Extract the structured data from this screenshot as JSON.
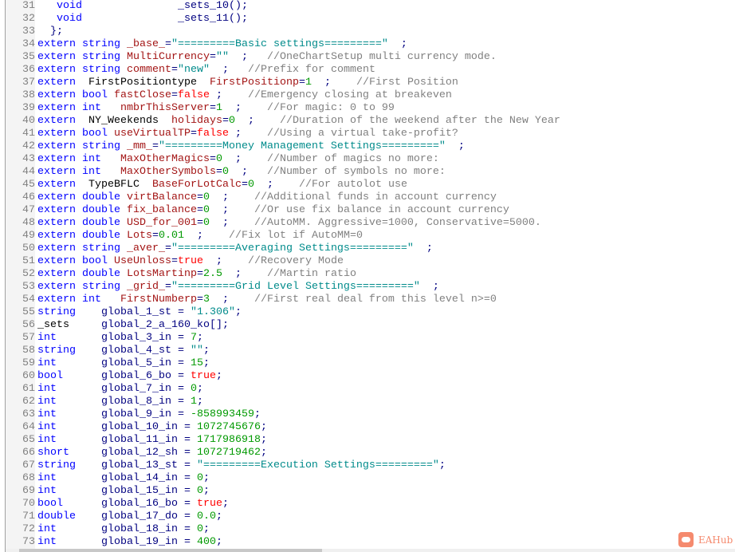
{
  "editor": {
    "lines": [
      {
        "no": "31",
        "tokens": [
          [
            "t",
            "   "
          ],
          [
            "k",
            "void"
          ],
          [
            "t",
            "               "
          ],
          [
            "p",
            "_sets_10();"
          ]
        ]
      },
      {
        "no": "32",
        "tokens": [
          [
            "t",
            "   "
          ],
          [
            "k",
            "void"
          ],
          [
            "t",
            "               "
          ],
          [
            "p",
            "_sets_11();"
          ]
        ]
      },
      {
        "no": "33",
        "tokens": [
          [
            "p",
            "  };"
          ]
        ]
      },
      {
        "no": "34",
        "tokens": [
          [
            "k",
            "extern string "
          ],
          [
            "i",
            "_base_"
          ],
          [
            "p",
            "="
          ],
          [
            "s",
            "\"=========Basic settings=========\""
          ],
          [
            "p",
            "  ;"
          ]
        ]
      },
      {
        "no": "35",
        "tokens": [
          [
            "k",
            "extern string "
          ],
          [
            "i",
            "MultiCurrency"
          ],
          [
            "p",
            "="
          ],
          [
            "s",
            "\"\""
          ],
          [
            "p",
            "  ;   "
          ],
          [
            "c",
            "//OneChartSetup multi currency mode."
          ]
        ]
      },
      {
        "no": "36",
        "tokens": [
          [
            "k",
            "extern string "
          ],
          [
            "i",
            "comment"
          ],
          [
            "p",
            "="
          ],
          [
            "s",
            "\"new\""
          ],
          [
            "p",
            "  ;   "
          ],
          [
            "c",
            "//Prefix for comment"
          ]
        ]
      },
      {
        "no": "37",
        "tokens": [
          [
            "k",
            "extern  "
          ],
          [
            "t",
            "FirstPositiontype  "
          ],
          [
            "i",
            "FirstPositionp"
          ],
          [
            "p",
            "="
          ],
          [
            "n",
            "1"
          ],
          [
            "p",
            "  ;    "
          ],
          [
            "c",
            "//First Position"
          ]
        ]
      },
      {
        "no": "38",
        "tokens": [
          [
            "k",
            "extern bool "
          ],
          [
            "i",
            "fastClose"
          ],
          [
            "p",
            "="
          ],
          [
            "b",
            "false"
          ],
          [
            "p",
            " ;    "
          ],
          [
            "c",
            "//Emergency closing at breakeven"
          ]
        ]
      },
      {
        "no": "39",
        "tokens": [
          [
            "k",
            "extern int   "
          ],
          [
            "i",
            "nmbrThisServer"
          ],
          [
            "p",
            "="
          ],
          [
            "n",
            "1"
          ],
          [
            "p",
            "  ;    "
          ],
          [
            "c",
            "//For magic: 0 to 99"
          ]
        ]
      },
      {
        "no": "40",
        "tokens": [
          [
            "k",
            "extern  "
          ],
          [
            "t",
            "NY_Weekends  "
          ],
          [
            "i",
            "holidays"
          ],
          [
            "p",
            "="
          ],
          [
            "n",
            "0"
          ],
          [
            "p",
            "  ;    "
          ],
          [
            "c",
            "//Duration of the weekend after the New Year"
          ]
        ]
      },
      {
        "no": "41",
        "tokens": [
          [
            "k",
            "extern bool "
          ],
          [
            "i",
            "useVirtualTP"
          ],
          [
            "p",
            "="
          ],
          [
            "b",
            "false"
          ],
          [
            "p",
            " ;    "
          ],
          [
            "c",
            "//Using a virtual take-profit?"
          ]
        ]
      },
      {
        "no": "42",
        "tokens": [
          [
            "k",
            "extern string "
          ],
          [
            "i",
            "_mm_"
          ],
          [
            "p",
            "="
          ],
          [
            "s",
            "\"=========Money Management Settings=========\""
          ],
          [
            "p",
            "  ;"
          ]
        ]
      },
      {
        "no": "43",
        "tokens": [
          [
            "k",
            "extern int   "
          ],
          [
            "i",
            "MaxOtherMagics"
          ],
          [
            "p",
            "="
          ],
          [
            "n",
            "0"
          ],
          [
            "p",
            "  ;    "
          ],
          [
            "c",
            "//Number of magics no more:"
          ]
        ]
      },
      {
        "no": "44",
        "tokens": [
          [
            "k",
            "extern int   "
          ],
          [
            "i",
            "MaxOtherSymbols"
          ],
          [
            "p",
            "="
          ],
          [
            "n",
            "0"
          ],
          [
            "p",
            "  ;   "
          ],
          [
            "c",
            "//Number of symbols no more:"
          ]
        ]
      },
      {
        "no": "45",
        "tokens": [
          [
            "k",
            "extern  "
          ],
          [
            "t",
            "TypeBFLC  "
          ],
          [
            "i",
            "BaseForLotCalc"
          ],
          [
            "p",
            "="
          ],
          [
            "n",
            "0"
          ],
          [
            "p",
            "  ;    "
          ],
          [
            "c",
            "//For autolot use"
          ]
        ]
      },
      {
        "no": "46",
        "tokens": [
          [
            "k",
            "extern double "
          ],
          [
            "i",
            "virtBalance"
          ],
          [
            "p",
            "="
          ],
          [
            "n",
            "0"
          ],
          [
            "p",
            "  ;    "
          ],
          [
            "c",
            "//Additional funds in account currency"
          ]
        ]
      },
      {
        "no": "47",
        "tokens": [
          [
            "k",
            "extern double "
          ],
          [
            "i",
            "fix_balance"
          ],
          [
            "p",
            "="
          ],
          [
            "n",
            "0"
          ],
          [
            "p",
            "  ;    "
          ],
          [
            "c",
            "//Or use fix balance in account currency"
          ]
        ]
      },
      {
        "no": "48",
        "tokens": [
          [
            "k",
            "extern double "
          ],
          [
            "i",
            "USD_for_001"
          ],
          [
            "p",
            "="
          ],
          [
            "n",
            "0"
          ],
          [
            "p",
            "  ;    "
          ],
          [
            "c",
            "//AutoMM. Aggressive=1000, Conservative=5000."
          ]
        ]
      },
      {
        "no": "49",
        "tokens": [
          [
            "k",
            "extern double "
          ],
          [
            "i",
            "Lots"
          ],
          [
            "p",
            "="
          ],
          [
            "n",
            "0.01"
          ],
          [
            "p",
            "  ;    "
          ],
          [
            "c",
            "//Fix lot if AutoMM=0"
          ]
        ]
      },
      {
        "no": "50",
        "tokens": [
          [
            "k",
            "extern string "
          ],
          [
            "i",
            "_aver_"
          ],
          [
            "p",
            "="
          ],
          [
            "s",
            "\"=========Averaging Settings=========\""
          ],
          [
            "p",
            "  ;"
          ]
        ]
      },
      {
        "no": "51",
        "tokens": [
          [
            "k",
            "extern bool "
          ],
          [
            "i",
            "UseUnloss"
          ],
          [
            "p",
            "="
          ],
          [
            "b",
            "true"
          ],
          [
            "p",
            "  ;    "
          ],
          [
            "c",
            "//Recovery Mode"
          ]
        ]
      },
      {
        "no": "52",
        "tokens": [
          [
            "k",
            "extern double "
          ],
          [
            "i",
            "LotsMartinp"
          ],
          [
            "p",
            "="
          ],
          [
            "n",
            "2.5"
          ],
          [
            "p",
            "  ;    "
          ],
          [
            "c",
            "//Martin ratio"
          ]
        ]
      },
      {
        "no": "53",
        "tokens": [
          [
            "k",
            "extern string "
          ],
          [
            "i",
            "_grid_"
          ],
          [
            "p",
            "="
          ],
          [
            "s",
            "\"=========Grid Level Settings=========\""
          ],
          [
            "p",
            "  ;"
          ]
        ]
      },
      {
        "no": "54",
        "tokens": [
          [
            "k",
            "extern int   "
          ],
          [
            "i",
            "FirstNumberp"
          ],
          [
            "p",
            "="
          ],
          [
            "n",
            "3"
          ],
          [
            "p",
            "  ;    "
          ],
          [
            "c",
            "//First real deal from this level n>=0"
          ]
        ]
      },
      {
        "no": "55",
        "tokens": [
          [
            "k",
            "string"
          ],
          [
            "p",
            "    global_1_st = "
          ],
          [
            "s",
            "\"1.306\""
          ],
          [
            "p",
            ";"
          ]
        ]
      },
      {
        "no": "56",
        "tokens": [
          [
            "t",
            "_sets"
          ],
          [
            "p",
            "     global_2_a_160_ko[];"
          ]
        ]
      },
      {
        "no": "57",
        "tokens": [
          [
            "k",
            "int"
          ],
          [
            "p",
            "       global_3_in = "
          ],
          [
            "n",
            "7"
          ],
          [
            "p",
            ";"
          ]
        ]
      },
      {
        "no": "58",
        "tokens": [
          [
            "k",
            "string"
          ],
          [
            "p",
            "    global_4_st = "
          ],
          [
            "s",
            "\"\""
          ],
          [
            "p",
            ";"
          ]
        ]
      },
      {
        "no": "59",
        "tokens": [
          [
            "k",
            "int"
          ],
          [
            "p",
            "       global_5_in = "
          ],
          [
            "n",
            "15"
          ],
          [
            "p",
            ";"
          ]
        ]
      },
      {
        "no": "60",
        "tokens": [
          [
            "k",
            "bool"
          ],
          [
            "p",
            "      global_6_bo = "
          ],
          [
            "b",
            "true"
          ],
          [
            "p",
            ";"
          ]
        ]
      },
      {
        "no": "61",
        "tokens": [
          [
            "k",
            "int"
          ],
          [
            "p",
            "       global_7_in = "
          ],
          [
            "n",
            "0"
          ],
          [
            "p",
            ";"
          ]
        ]
      },
      {
        "no": "62",
        "tokens": [
          [
            "k",
            "int"
          ],
          [
            "p",
            "       global_8_in = "
          ],
          [
            "n",
            "1"
          ],
          [
            "p",
            ";"
          ]
        ]
      },
      {
        "no": "63",
        "tokens": [
          [
            "k",
            "int"
          ],
          [
            "p",
            "       global_9_in = "
          ],
          [
            "n",
            "-858993459"
          ],
          [
            "p",
            ";"
          ]
        ]
      },
      {
        "no": "64",
        "tokens": [
          [
            "k",
            "int"
          ],
          [
            "p",
            "       global_10_in = "
          ],
          [
            "n",
            "1072745676"
          ],
          [
            "p",
            ";"
          ]
        ]
      },
      {
        "no": "65",
        "tokens": [
          [
            "k",
            "int"
          ],
          [
            "p",
            "       global_11_in = "
          ],
          [
            "n",
            "1717986918"
          ],
          [
            "p",
            ";"
          ]
        ]
      },
      {
        "no": "66",
        "tokens": [
          [
            "k",
            "short"
          ],
          [
            "p",
            "     global_12_sh = "
          ],
          [
            "n",
            "1072719462"
          ],
          [
            "p",
            ";"
          ]
        ]
      },
      {
        "no": "67",
        "tokens": [
          [
            "k",
            "string"
          ],
          [
            "p",
            "    global_13_st = "
          ],
          [
            "s",
            "\"=========Execution Settings=========\""
          ],
          [
            "p",
            ";"
          ]
        ]
      },
      {
        "no": "68",
        "tokens": [
          [
            "k",
            "int"
          ],
          [
            "p",
            "       global_14_in = "
          ],
          [
            "n",
            "0"
          ],
          [
            "p",
            ";"
          ]
        ]
      },
      {
        "no": "69",
        "tokens": [
          [
            "k",
            "int"
          ],
          [
            "p",
            "       global_15_in = "
          ],
          [
            "n",
            "0"
          ],
          [
            "p",
            ";"
          ]
        ]
      },
      {
        "no": "70",
        "tokens": [
          [
            "k",
            "bool"
          ],
          [
            "p",
            "      global_16_bo = "
          ],
          [
            "b",
            "true"
          ],
          [
            "p",
            ";"
          ]
        ]
      },
      {
        "no": "71",
        "tokens": [
          [
            "k",
            "double"
          ],
          [
            "p",
            "    global_17_do = "
          ],
          [
            "n",
            "0.0"
          ],
          [
            "p",
            ";"
          ]
        ]
      },
      {
        "no": "72",
        "tokens": [
          [
            "k",
            "int"
          ],
          [
            "p",
            "       global_18_in = "
          ],
          [
            "n",
            "0"
          ],
          [
            "p",
            ";"
          ]
        ]
      },
      {
        "no": "73",
        "tokens": [
          [
            "k",
            "int"
          ],
          [
            "p",
            "       global_19_in = "
          ],
          [
            "n",
            "400"
          ],
          [
            "p",
            ";"
          ]
        ]
      }
    ]
  },
  "watermark": {
    "text": "EAHub",
    "color": "#f58a6e"
  }
}
